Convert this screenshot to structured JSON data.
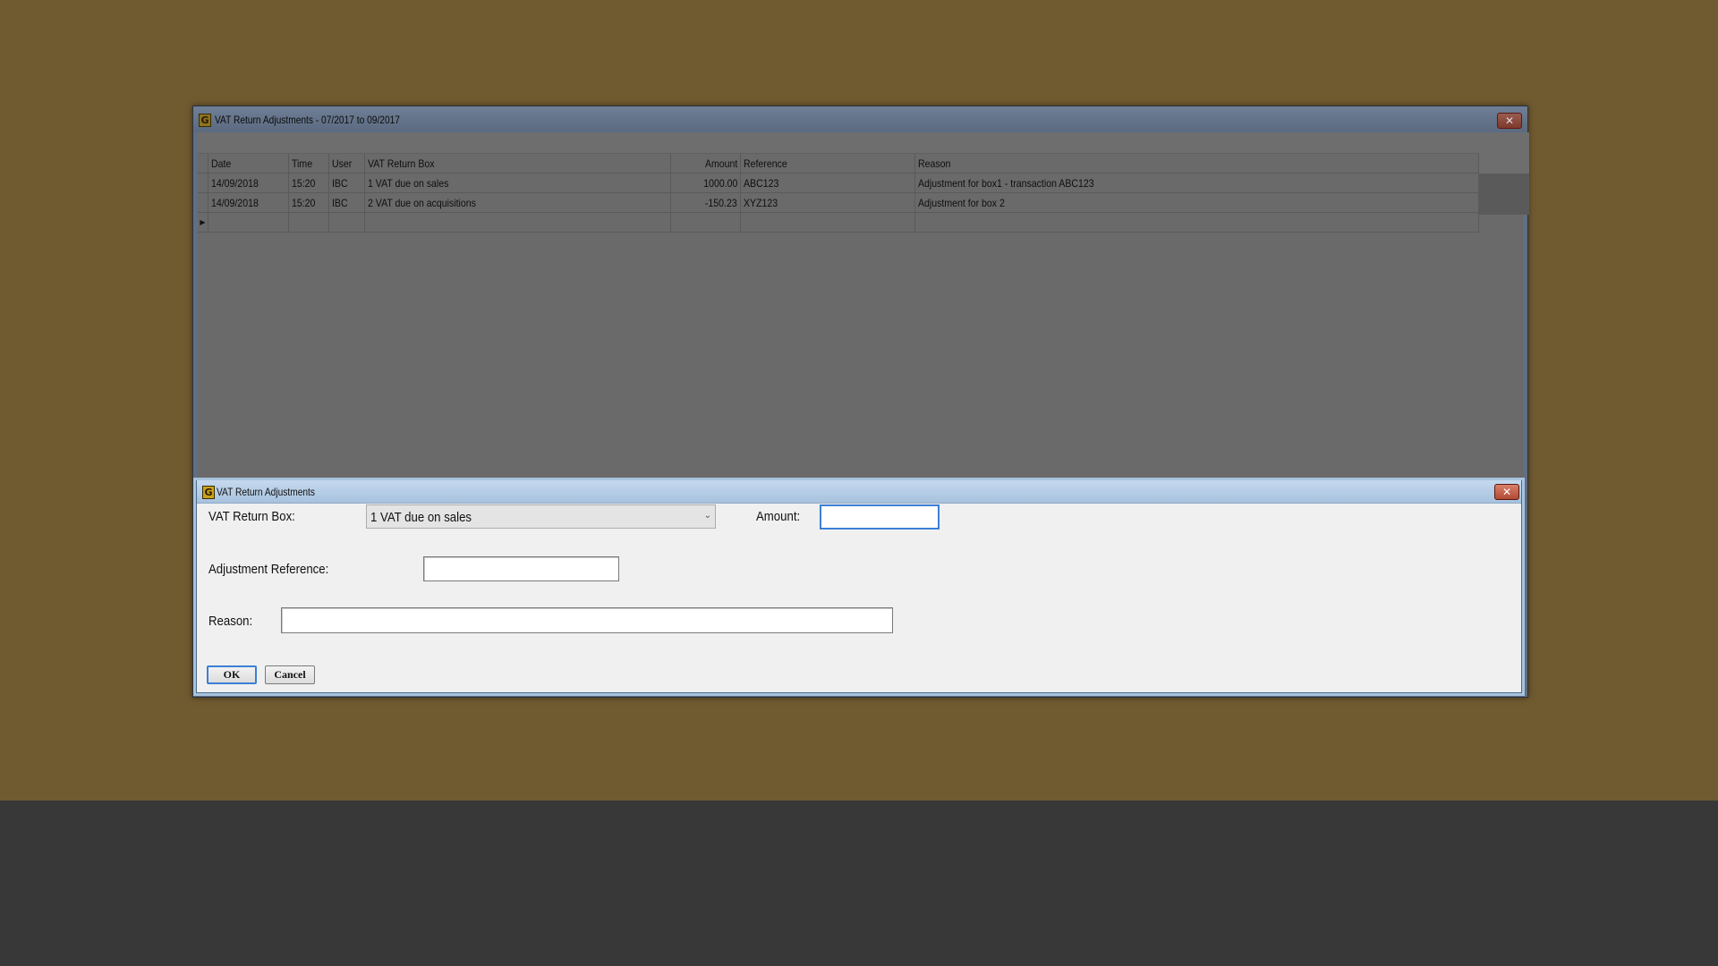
{
  "main_window": {
    "title": "VAT Return Adjustments - 07/2017 to 09/2017",
    "app_icon": "G",
    "close_glyph": "✕"
  },
  "grid": {
    "columns": [
      "Date",
      "Time",
      "User",
      "VAT Return Box",
      "Amount",
      "Reference",
      "Reason"
    ],
    "rows": [
      [
        "14/09/2018",
        "15:20",
        "IBC",
        "1 VAT due on sales",
        "1000.00",
        "ABC123",
        "Adjustment for box1 - transaction ABC123"
      ],
      [
        "14/09/2018",
        "15:20",
        "IBC",
        "2 VAT due on acquisitions",
        "-150.23",
        "XYZ123",
        "Adjustment for box 2"
      ]
    ],
    "selected_row": 1,
    "new_row_indicator": "▶"
  },
  "dialog": {
    "title": "VAT Return Adjustments",
    "app_icon": "G",
    "close_glyph": "✕",
    "vat_box_label": "VAT Return Box:",
    "vat_box_value": "1 VAT due on sales",
    "amount_label": "Amount:",
    "amount_value": "",
    "adj_ref_label": "Adjustment Reference:",
    "adj_ref_value": "",
    "reason_label": "Reason:",
    "reason_value": "",
    "ok_label": "OK",
    "cancel_label": "Cancel",
    "chevron_icon": "chevron-down-icon"
  },
  "colors": {
    "desktop": "#705a30",
    "taskbar_area": "#383838",
    "selected_row": "#8a8e48",
    "focus": "#3c7fd6"
  }
}
